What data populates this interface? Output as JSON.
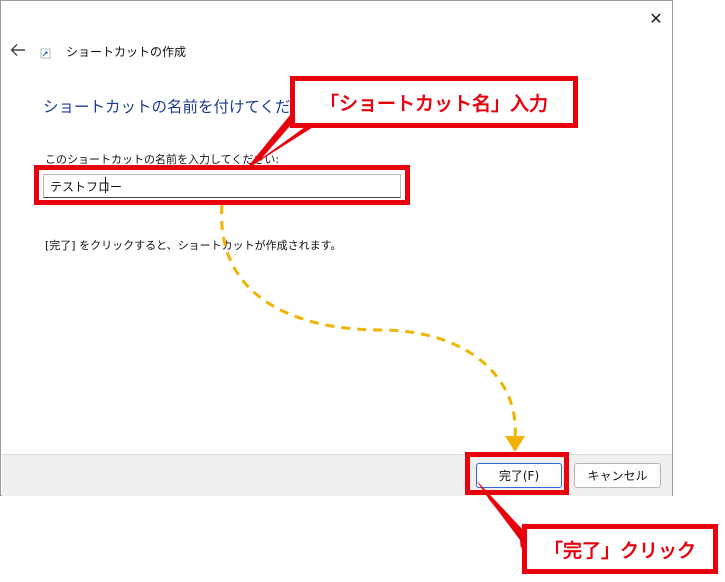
{
  "window": {
    "title": "ショートカットの作成",
    "close_glyph": "✕"
  },
  "main": {
    "heading": "ショートカットの名前を付けてください",
    "field_label": "このショートカットの名前を入力してください:",
    "name_value": "テストフロー",
    "info": "[完了] をクリックすると、ショートカットが作成されます。"
  },
  "footer": {
    "finish_label": "完了(F)",
    "cancel_label": "キャンセル"
  },
  "annotations": {
    "callout_name": "「ショートカット名」入力",
    "callout_finish": "「完了」クリック",
    "highlight_color": "#e8000d",
    "arrow_color": "#f0b400"
  }
}
